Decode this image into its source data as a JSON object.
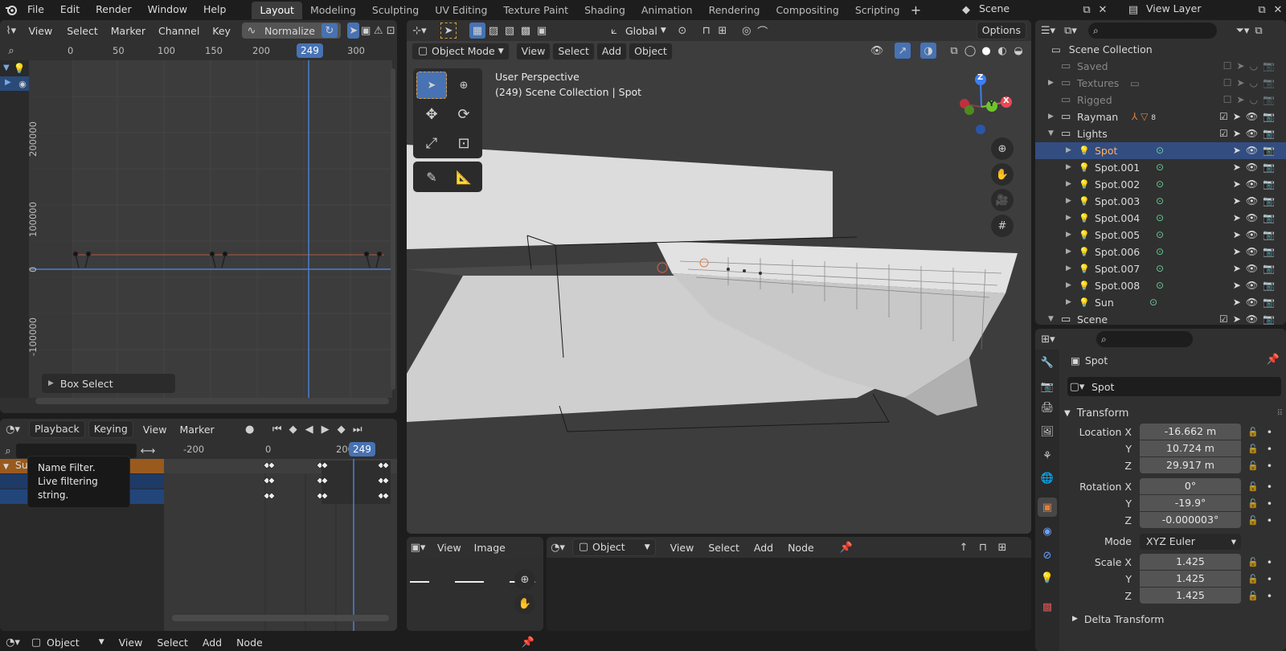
{
  "topbar": {
    "menus": [
      "File",
      "Edit",
      "Render",
      "Window",
      "Help"
    ],
    "workspaces": [
      "Layout",
      "Modeling",
      "Sculpting",
      "UV Editing",
      "Texture Paint",
      "Shading",
      "Animation",
      "Rendering",
      "Compositing",
      "Scripting"
    ],
    "active_workspace": "Layout",
    "scene_name": "Scene",
    "view_layer": "View Layer"
  },
  "graph_editor": {
    "menus": [
      "View",
      "Select",
      "Marker",
      "Channel",
      "Key"
    ],
    "normalize_label": "Normalize",
    "frame_ticks": [
      "0",
      "50",
      "100",
      "150",
      "200",
      "300"
    ],
    "current_frame": "249",
    "value_ticks": [
      "200000",
      "100000",
      "0",
      "-100000"
    ],
    "box_select_label": "Box Select"
  },
  "timeline": {
    "menus": [
      "Playback",
      "Keying",
      "View",
      "Marker"
    ],
    "frame_ticks": [
      "-200",
      "0",
      "200"
    ],
    "current_frame": "249",
    "channel_label": "Su",
    "tooltip_title": "Name Filter.",
    "tooltip_body": "Live filtering string."
  },
  "viewport": {
    "transform_orientation": "Global",
    "options_label": "Options",
    "mode": "Object Mode",
    "menus": [
      "View",
      "Select",
      "Add",
      "Object"
    ],
    "overlay_line1": "User Perspective",
    "overlay_line2": "(249) Scene Collection | Spot",
    "gizmo_axes": [
      "Z",
      "Y",
      "X"
    ]
  },
  "image_editor": {
    "menus": [
      "View",
      "Image"
    ]
  },
  "node_editor": {
    "mode": "Object",
    "menus": [
      "View",
      "Select",
      "Add",
      "Node"
    ]
  },
  "status_node": {
    "mode": "Object",
    "menus": [
      "View",
      "Select",
      "Add",
      "Node"
    ]
  },
  "outliner": {
    "root": "Scene Collection",
    "items": [
      {
        "label": "Saved",
        "muted": true
      },
      {
        "label": "Textures",
        "muted": true
      },
      {
        "label": "Rigged",
        "muted": true
      },
      {
        "label": "Rayman",
        "muted": false
      },
      {
        "label": "Lights",
        "muted": false
      },
      {
        "label": "Spot",
        "selected": true
      },
      {
        "label": "Spot.001"
      },
      {
        "label": "Spot.002"
      },
      {
        "label": "Spot.003"
      },
      {
        "label": "Spot.004"
      },
      {
        "label": "Spot.005"
      },
      {
        "label": "Spot.006"
      },
      {
        "label": "Spot.007"
      },
      {
        "label": "Spot.008"
      },
      {
        "label": "Sun"
      },
      {
        "label": "Scene"
      }
    ],
    "rayman_modifier_count": "8"
  },
  "properties": {
    "object_name": "Spot",
    "data_name": "Spot",
    "transform_label": "Transform",
    "location_label": "Location X",
    "rotation_label": "Rotation X",
    "scale_label": "Scale X",
    "axis_y": "Y",
    "axis_z": "Z",
    "location": [
      "-16.662 m",
      "10.724 m",
      "29.917 m"
    ],
    "rotation": [
      "0°",
      "-19.9°",
      "-0.000003°"
    ],
    "mode_label": "Mode",
    "mode_value": "XYZ Euler",
    "scale": [
      "1.425",
      "1.425",
      "1.425"
    ],
    "delta_transform_label": "Delta Transform"
  },
  "colors": {
    "accent_blue": "#4772b3",
    "selected_row": "#334d80",
    "orange_light": "#e09040"
  }
}
